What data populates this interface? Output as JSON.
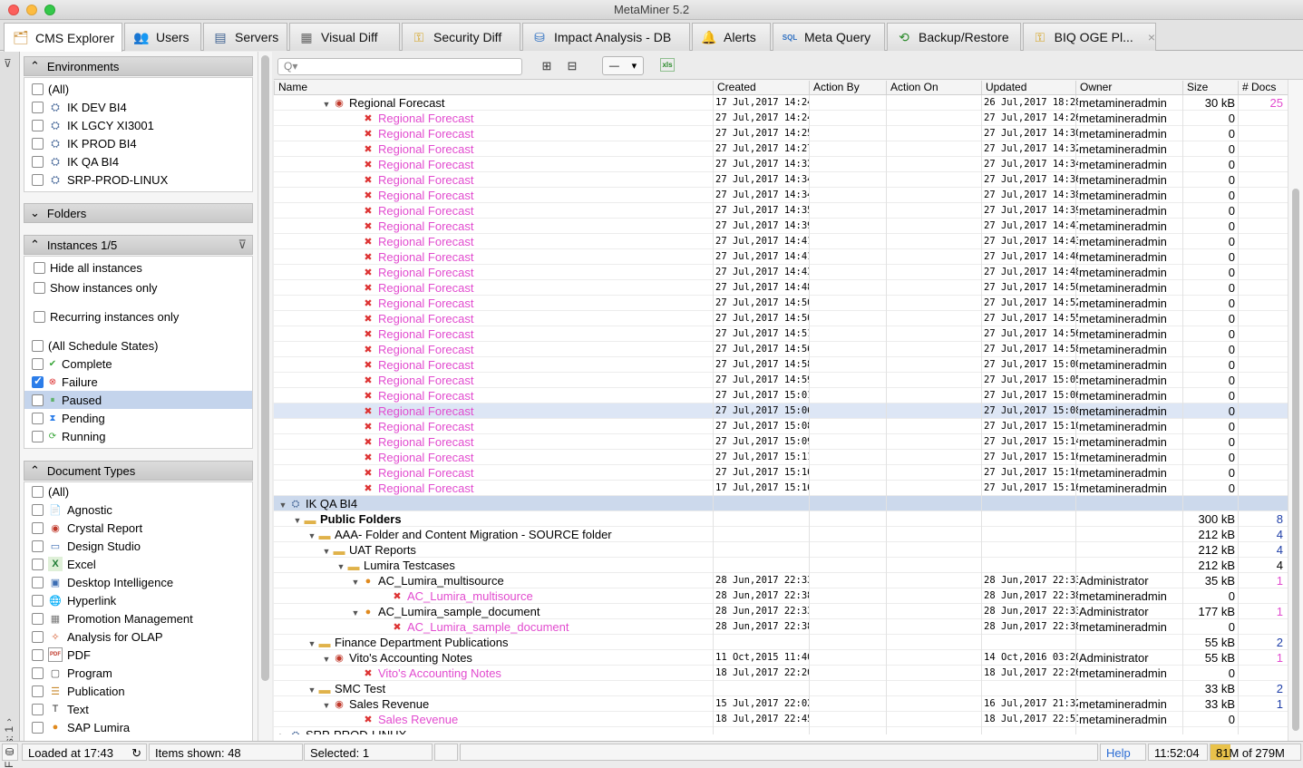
{
  "window": {
    "title": "MetaMiner 5.2"
  },
  "tabs": [
    {
      "label": "CMS Explorer",
      "icon": "cms-explorer-icon"
    },
    {
      "label": "Users",
      "icon": "users-icon"
    },
    {
      "label": "Servers",
      "icon": "servers-icon"
    },
    {
      "label": "Visual Diff",
      "icon": "visual-diff-icon"
    },
    {
      "label": "Security Diff",
      "icon": "key-icon"
    },
    {
      "label": "Impact Analysis - DB",
      "icon": "database-icon"
    },
    {
      "label": "Alerts",
      "icon": "bell-icon"
    },
    {
      "label": "Meta Query",
      "icon": "sql-icon"
    },
    {
      "label": "Backup/Restore",
      "icon": "clock-icon"
    },
    {
      "label": "BIQ OGE Pl...",
      "icon": "key-icon",
      "close": "×"
    }
  ],
  "sidebar": {
    "filters_label": "Filters: 1",
    "environments": {
      "title": "Environments",
      "items": [
        "(All)",
        "IK DEV BI4",
        "IK LGCY  XI3001",
        "IK PROD BI4",
        "IK QA BI4",
        "SRP-PROD-LINUX"
      ]
    },
    "folders": {
      "title": "Folders"
    },
    "instances": {
      "title": "Instances 1/5",
      "options": [
        "Hide all instances",
        "Show instances only",
        "Recurring instances only"
      ],
      "states": [
        {
          "label": "(All Schedule States)",
          "checked": false
        },
        {
          "label": "Complete",
          "checked": false,
          "icon": "complete-icon",
          "color": "#3aa63a"
        },
        {
          "label": "Failure",
          "checked": true,
          "icon": "failure-icon",
          "color": "#d33"
        },
        {
          "label": "Paused",
          "checked": false,
          "icon": "paused-icon",
          "color": "#3aa63a"
        },
        {
          "label": "Pending",
          "checked": false,
          "icon": "pending-icon",
          "color": "#2b7de9"
        },
        {
          "label": "Running",
          "checked": false,
          "icon": "running-icon",
          "color": "#3aa63a"
        }
      ]
    },
    "document_types": {
      "title": "Document Types",
      "items": [
        "(All)",
        "Agnostic",
        "Crystal Report",
        "Design Studio",
        "Excel",
        "Desktop Intelligence",
        "Hyperlink",
        "Promotion Management",
        "Analysis for OLAP",
        "PDF",
        "Program",
        "Publication",
        "Text",
        "SAP Lumira"
      ]
    }
  },
  "toolbar": {
    "search_placeholder": "Q▾",
    "expand": "⊞",
    "collapse": "⊟",
    "dropdown": "—",
    "dropdown_arrow": "▾",
    "export": "xls"
  },
  "columns": [
    "Name",
    "Created",
    "Action By",
    "Action On",
    "Updated",
    "Owner",
    "Size",
    "# Docs"
  ],
  "rows": [
    {
      "indent": 3,
      "tri": "▼",
      "icon": "crystal",
      "name": "Regional Forecast",
      "created": "17 Jul,2017 14:24",
      "updated": "26 Jul,2017 18:28",
      "owner": "metamineradmin",
      "size": "30 kB",
      "docs": "25",
      "pink": false,
      "docsPink": true
    },
    {
      "indent": 5,
      "icon": "fail",
      "name": "Regional Forecast",
      "created": "27 Jul,2017 14:24",
      "updated": "27 Jul,2017 14:26",
      "owner": "metamineradmin",
      "size": "0",
      "pink": true
    },
    {
      "indent": 5,
      "icon": "fail",
      "name": "Regional Forecast",
      "created": "27 Jul,2017 14:25",
      "updated": "27 Jul,2017 14:30",
      "owner": "metamineradmin",
      "size": "0",
      "pink": true
    },
    {
      "indent": 5,
      "icon": "fail",
      "name": "Regional Forecast",
      "created": "27 Jul,2017 14:27",
      "updated": "27 Jul,2017 14:32",
      "owner": "metamineradmin",
      "size": "0",
      "pink": true
    },
    {
      "indent": 5,
      "icon": "fail",
      "name": "Regional Forecast",
      "created": "27 Jul,2017 14:32",
      "updated": "27 Jul,2017 14:34",
      "owner": "metamineradmin",
      "size": "0",
      "pink": true
    },
    {
      "indent": 5,
      "icon": "fail",
      "name": "Regional Forecast",
      "created": "27 Jul,2017 14:34",
      "updated": "27 Jul,2017 14:36",
      "owner": "metamineradmin",
      "size": "0",
      "pink": true
    },
    {
      "indent": 5,
      "icon": "fail",
      "name": "Regional Forecast",
      "created": "27 Jul,2017 14:34",
      "updated": "27 Jul,2017 14:38",
      "owner": "metamineradmin",
      "size": "0",
      "pink": true
    },
    {
      "indent": 5,
      "icon": "fail",
      "name": "Regional Forecast",
      "created": "27 Jul,2017 14:35",
      "updated": "27 Jul,2017 14:39",
      "owner": "metamineradmin",
      "size": "0",
      "pink": true
    },
    {
      "indent": 5,
      "icon": "fail",
      "name": "Regional Forecast",
      "created": "27 Jul,2017 14:39",
      "updated": "27 Jul,2017 14:41",
      "owner": "metamineradmin",
      "size": "0",
      "pink": true
    },
    {
      "indent": 5,
      "icon": "fail",
      "name": "Regional Forecast",
      "created": "27 Jul,2017 14:41",
      "updated": "27 Jul,2017 14:43",
      "owner": "metamineradmin",
      "size": "0",
      "pink": true
    },
    {
      "indent": 5,
      "icon": "fail",
      "name": "Regional Forecast",
      "created": "27 Jul,2017 14:41",
      "updated": "27 Jul,2017 14:46",
      "owner": "metamineradmin",
      "size": "0",
      "pink": true
    },
    {
      "indent": 5,
      "icon": "fail",
      "name": "Regional Forecast",
      "created": "27 Jul,2017 14:43",
      "updated": "27 Jul,2017 14:48",
      "owner": "metamineradmin",
      "size": "0",
      "pink": true
    },
    {
      "indent": 5,
      "icon": "fail",
      "name": "Regional Forecast",
      "created": "27 Jul,2017 14:48",
      "updated": "27 Jul,2017 14:50",
      "owner": "metamineradmin",
      "size": "0",
      "pink": true
    },
    {
      "indent": 5,
      "icon": "fail",
      "name": "Regional Forecast",
      "created": "27 Jul,2017 14:50",
      "updated": "27 Jul,2017 14:52",
      "owner": "metamineradmin",
      "size": "0",
      "pink": true
    },
    {
      "indent": 5,
      "icon": "fail",
      "name": "Regional Forecast",
      "created": "27 Jul,2017 14:50",
      "updated": "27 Jul,2017 14:55",
      "owner": "metamineradmin",
      "size": "0",
      "pink": true
    },
    {
      "indent": 5,
      "icon": "fail",
      "name": "Regional Forecast",
      "created": "27 Jul,2017 14:51",
      "updated": "27 Jul,2017 14:56",
      "owner": "metamineradmin",
      "size": "0",
      "pink": true
    },
    {
      "indent": 5,
      "icon": "fail",
      "name": "Regional Forecast",
      "created": "27 Jul,2017 14:56",
      "updated": "27 Jul,2017 14:58",
      "owner": "metamineradmin",
      "size": "0",
      "pink": true
    },
    {
      "indent": 5,
      "icon": "fail",
      "name": "Regional Forecast",
      "created": "27 Jul,2017 14:58",
      "updated": "27 Jul,2017 15:00",
      "owner": "metamineradmin",
      "size": "0",
      "pink": true
    },
    {
      "indent": 5,
      "icon": "fail",
      "name": "Regional Forecast",
      "created": "27 Jul,2017 14:59",
      "updated": "27 Jul,2017 15:05",
      "owner": "metamineradmin",
      "size": "0",
      "pink": true
    },
    {
      "indent": 5,
      "icon": "fail",
      "name": "Regional Forecast",
      "created": "27 Jul,2017 15:01",
      "updated": "27 Jul,2017 15:06",
      "owner": "metamineradmin",
      "size": "0",
      "pink": true
    },
    {
      "indent": 5,
      "icon": "fail",
      "name": "Regional Forecast",
      "created": "27 Jul,2017 15:06",
      "updated": "27 Jul,2017 15:08",
      "owner": "metamineradmin",
      "size": "0",
      "pink": true,
      "selected": true
    },
    {
      "indent": 5,
      "icon": "fail",
      "name": "Regional Forecast",
      "created": "27 Jul,2017 15:08",
      "updated": "27 Jul,2017 15:10",
      "owner": "metamineradmin",
      "size": "0",
      "pink": true
    },
    {
      "indent": 5,
      "icon": "fail",
      "name": "Regional Forecast",
      "created": "27 Jul,2017 15:09",
      "updated": "27 Jul,2017 15:14",
      "owner": "metamineradmin",
      "size": "0",
      "pink": true
    },
    {
      "indent": 5,
      "icon": "fail",
      "name": "Regional Forecast",
      "created": "27 Jul,2017 15:11",
      "updated": "27 Jul,2017 15:16",
      "owner": "metamineradmin",
      "size": "0",
      "pink": true
    },
    {
      "indent": 5,
      "icon": "fail",
      "name": "Regional Forecast",
      "created": "27 Jul,2017 15:16",
      "updated": "27 Jul,2017 15:16",
      "owner": "metamineradmin",
      "size": "0",
      "pink": true
    },
    {
      "indent": 5,
      "icon": "fail",
      "name": "Regional Forecast",
      "created": "17 Jul,2017 15:16",
      "updated": "27 Jul,2017 15:16",
      "owner": "metamineradmin",
      "size": "0",
      "pink": true
    },
    {
      "indent": 0,
      "tri": "▼",
      "icon": "server",
      "name": "IK QA BI4",
      "group": true
    },
    {
      "indent": 1,
      "tri": "▼",
      "icon": "folder",
      "name": "Public Folders",
      "bold": true,
      "size": "300 kB",
      "docs": "8"
    },
    {
      "indent": 2,
      "tri": "▼",
      "icon": "folder",
      "name": "AAA- Folder and Content Migration - SOURCE folder",
      "size": "212 kB",
      "docs": "4"
    },
    {
      "indent": 3,
      "tri": "▼",
      "icon": "folder",
      "name": "UAT Reports",
      "size": "212 kB",
      "docs": "4"
    },
    {
      "indent": 4,
      "tri": "▼",
      "icon": "folder",
      "name": "Lumira Testcases",
      "size": "212 kB",
      "docs": "4",
      "docsBlack": true
    },
    {
      "indent": 5,
      "tri": "▼",
      "icon": "lumira",
      "name": "AC_Lumira_multisource",
      "created": "28 Jun,2017 22:33",
      "updated": "28 Jun,2017 22:33",
      "owner": "Administrator",
      "size": "35 kB",
      "docs": "1",
      "docsPink": true
    },
    {
      "indent": 7,
      "icon": "lumirafail",
      "name": "AC_Lumira_multisource",
      "created": "28 Jun,2017 22:38",
      "updated": "28 Jun,2017 22:38",
      "owner": "metamineradmin",
      "size": "0",
      "pink": true
    },
    {
      "indent": 5,
      "tri": "▼",
      "icon": "lumira",
      "name": "AC_Lumira_sample_document",
      "created": "28 Jun,2017 22:33",
      "updated": "28 Jun,2017 22:33",
      "owner": "Administrator",
      "size": "177 kB",
      "docs": "1",
      "docsPink": true
    },
    {
      "indent": 7,
      "icon": "lumirafail",
      "name": "AC_Lumira_sample_document",
      "created": "28 Jun,2017 22:38",
      "updated": "28 Jun,2017 22:38",
      "owner": "metamineradmin",
      "size": "0",
      "pink": true
    },
    {
      "indent": 2,
      "tri": "▼",
      "icon": "folder",
      "name": "Finance Department Publications",
      "size": "55 kB",
      "docs": "2"
    },
    {
      "indent": 3,
      "tri": "▼",
      "icon": "crystal",
      "name": "Vito's Accounting Notes",
      "created": "11 Oct,2015 11:40",
      "updated": "14 Oct,2016 03:20",
      "owner": "Administrator",
      "size": "55 kB",
      "docs": "1",
      "docsPink": true
    },
    {
      "indent": 5,
      "icon": "fail",
      "name": "Vito's Accounting Notes",
      "created": "18 Jul,2017 22:20",
      "updated": "18 Jul,2017 22:26",
      "owner": "metamineradmin",
      "size": "0",
      "pink": true
    },
    {
      "indent": 2,
      "tri": "▼",
      "icon": "folder",
      "name": "SMC Test",
      "size": "33 kB",
      "docs": "2"
    },
    {
      "indent": 3,
      "tri": "▼",
      "icon": "crystal",
      "name": "Sales Revenue",
      "created": "15 Jul,2017 22:02",
      "updated": "16 Jul,2017 21:32",
      "owner": "metamineradmin",
      "size": "33 kB",
      "docs": "1"
    },
    {
      "indent": 5,
      "icon": "fail",
      "name": "Sales Revenue",
      "created": "18 Jul,2017 22:45",
      "updated": "18 Jul,2017 22:51",
      "owner": "metamineradmin",
      "size": "0",
      "pink": true
    },
    {
      "indent": 0,
      "tri": "▶",
      "icon": "server",
      "name": "SRP-PROD-LINUX"
    }
  ],
  "status": {
    "loaded": "Loaded at 17:43",
    "items": "Items shown: 48",
    "selected": "Selected: 1",
    "help": "Help",
    "time": "11:52:04",
    "memory": "81M of 279M"
  },
  "colors": {
    "pink": "#e24bcf",
    "docs_blue": "#1f3fa8",
    "selection": "#dde6f5",
    "group": "#ccd9ec"
  }
}
